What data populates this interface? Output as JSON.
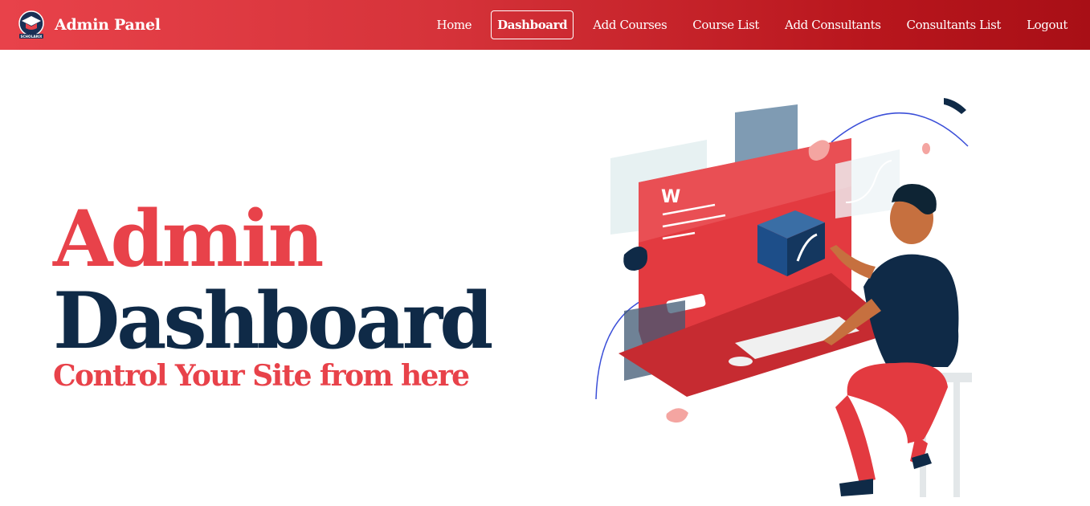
{
  "navbar": {
    "brand_title": "Admin Panel",
    "logo_text": "SCHOLARIX",
    "items": [
      {
        "label": "Home",
        "active": false
      },
      {
        "label": "Dashboard",
        "active": true
      },
      {
        "label": "Add Courses",
        "active": false
      },
      {
        "label": "Course List",
        "active": false
      },
      {
        "label": "Add Consultants",
        "active": false
      },
      {
        "label": "Consultants List",
        "active": false
      },
      {
        "label": "Logout",
        "active": false
      }
    ]
  },
  "hero": {
    "title_line1": "Admin",
    "title_line2": "Dashboard",
    "subtitle": "Control Your Site from here"
  },
  "illustration": {
    "screen_logo": "W",
    "subject": "person-at-computer-illustration"
  },
  "colors": {
    "primary_red": "#e8424a",
    "dark_navy": "#0f2a47",
    "nav_gradient_end": "#a80f16"
  }
}
